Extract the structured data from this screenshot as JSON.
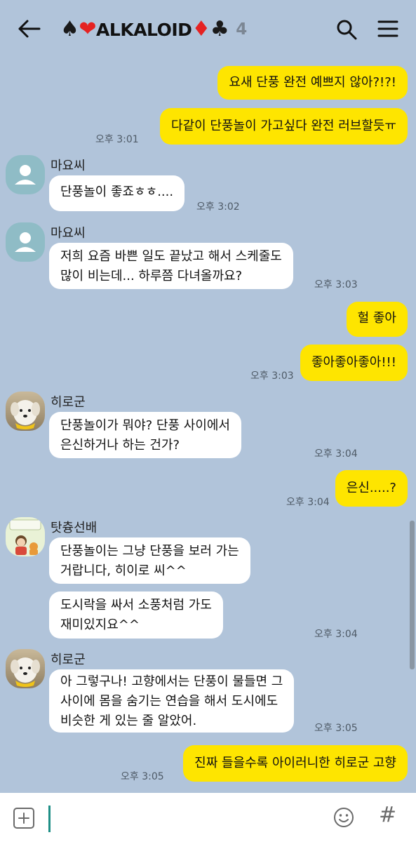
{
  "header": {
    "title": "ALKALOID",
    "suits": {
      "spade": "♠",
      "heart": "❤",
      "diamond": "♦",
      "club": "♣"
    },
    "member_count": "4"
  },
  "messages": [
    {
      "id": "m1",
      "sender": "me",
      "text": [
        "요새 단풍 완전 예쁘지 않아?!?!"
      ]
    },
    {
      "id": "m2",
      "sender": "me",
      "text": [
        "다같이 단풍놀이 가고싶다 완전 러브할듯ㅠ"
      ],
      "time": "오후 3:01"
    },
    {
      "id": "m3",
      "sender": "마요씨",
      "text": [
        "단풍놀이 좋죠ㅎㅎ...."
      ],
      "time": "오후 3:02"
    },
    {
      "id": "m4",
      "sender": "마요씨",
      "text": [
        "저희 요즘 바쁜 일도 끝났고 해서 스케줄도",
        "많이 비는데... 하루쯤 다녀올까요?"
      ],
      "time": "오후 3:03"
    },
    {
      "id": "m5",
      "sender": "me",
      "text": [
        "헐 좋아"
      ]
    },
    {
      "id": "m6",
      "sender": "me",
      "text": [
        "좋아좋아좋아!!!"
      ],
      "time": "오후 3:03"
    },
    {
      "id": "m7",
      "sender": "히로군",
      "text": [
        "단풍놀이가 뭐야? 단풍 사이에서",
        "은신하거나 하는 건가?"
      ],
      "time": "오후 3:04"
    },
    {
      "id": "m8",
      "sender": "me",
      "text": [
        "은신.....?"
      ],
      "time": "오후 3:04"
    },
    {
      "id": "m9",
      "sender": "탓츙선배",
      "text": [
        "단풍놀이는 그냥 단풍을 보러 가는",
        "거랍니다, 히이로 씨^^"
      ]
    },
    {
      "id": "m10",
      "sender": "탓츙선배",
      "text": [
        "도시락을 싸서 소풍처럼 가도",
        "재미있지요^^"
      ],
      "time": "오후 3:04"
    },
    {
      "id": "m11",
      "sender": "히로군",
      "text": [
        "아 그렇구나! 고향에서는 단풍이 물들면 그",
        "사이에 몸을 숨기는 연습을 해서 도시에도",
        "비슷한 게 있는 줄 알았어."
      ],
      "time": "오후 3:05"
    },
    {
      "id": "m12",
      "sender": "me",
      "text": [
        "진짜 들을수록 아이러니한 히로군 고향"
      ],
      "time": "오후 3:05"
    }
  ],
  "colors": {
    "background": "#b1c4da",
    "my_bubble": "#fee500",
    "their_bubble": "#ffffff",
    "caret": "#1e8f86"
  },
  "icons": {
    "back": "arrow-left-icon",
    "search": "search-icon",
    "menu": "hamburger-menu-icon",
    "attach": "plus-square-icon",
    "emoji": "smiley-icon",
    "hashtag": "hash-icon"
  },
  "input": {
    "hash_symbol": "#",
    "value": ""
  }
}
